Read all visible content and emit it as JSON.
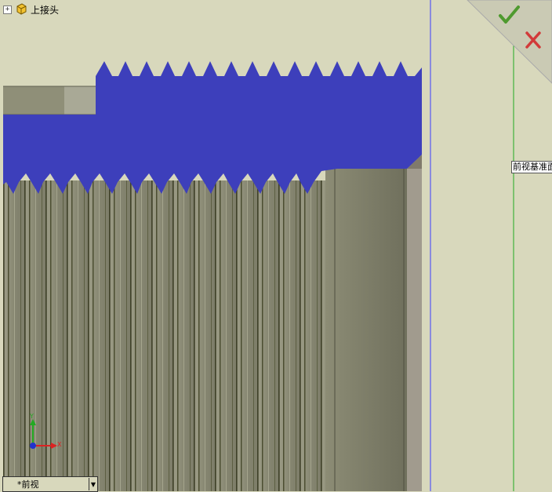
{
  "feature_tree": {
    "expander": "+",
    "part_name": "上接头",
    "part_icon": "part-icon"
  },
  "confirm": {
    "ok_icon": "checkmark-icon",
    "cancel_icon": "close-icon"
  },
  "plane_label": "前视基准面",
  "view_selector": {
    "value": "*前视"
  },
  "triad": {
    "x_label": "X",
    "y_label": "Y"
  },
  "colors": {
    "background": "#d8d8bc",
    "section_fill": "#3d3fbb",
    "thread_surface": "#8a8a72",
    "plane_line": "#22aa22"
  }
}
